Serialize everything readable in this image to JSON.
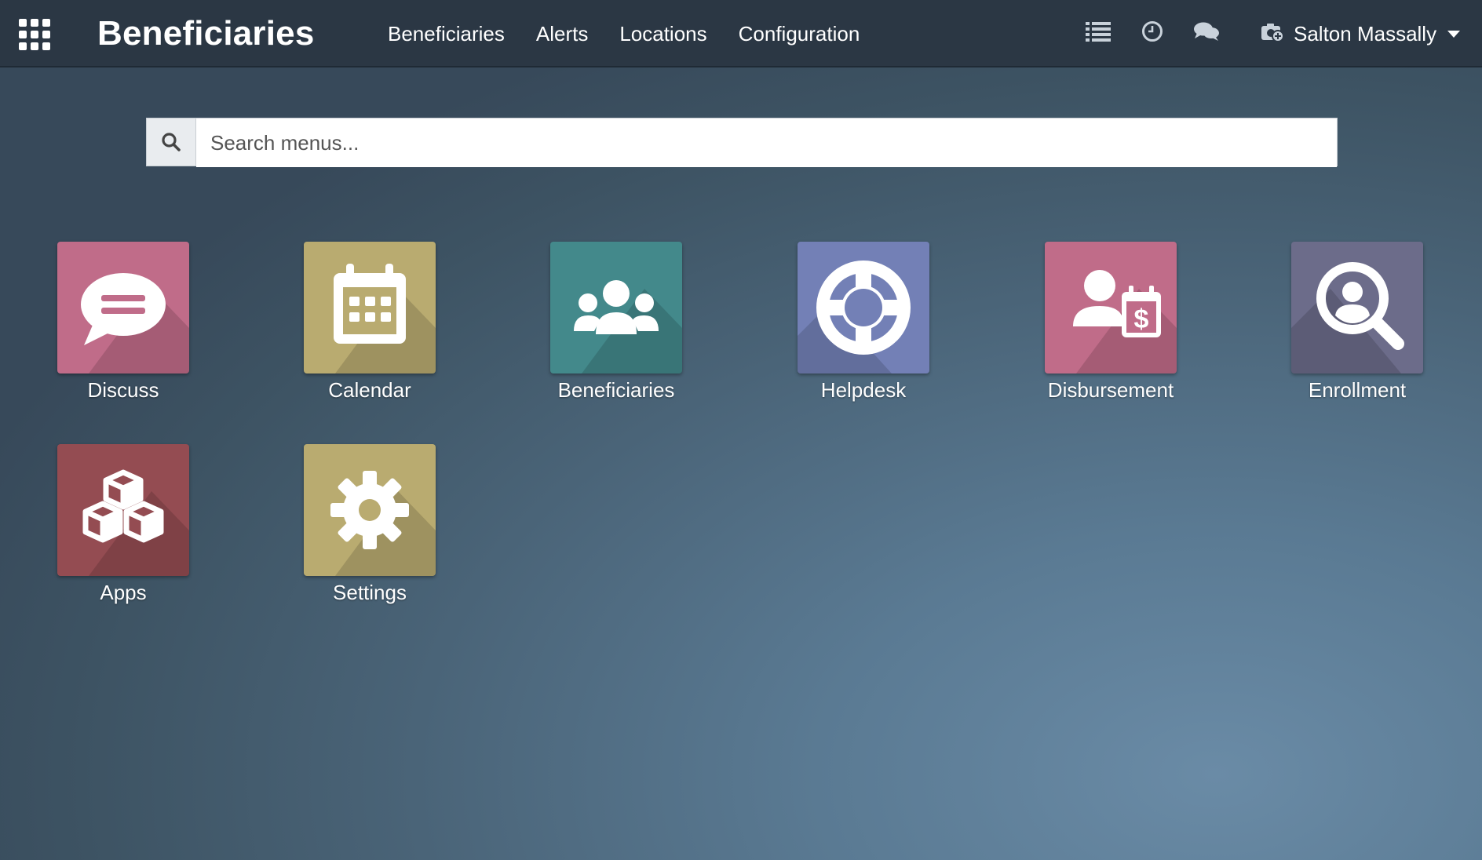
{
  "navbar": {
    "brand": "Beneficiaries",
    "menu": [
      {
        "label": "Beneficiaries"
      },
      {
        "label": "Alerts"
      },
      {
        "label": "Locations"
      },
      {
        "label": "Configuration"
      }
    ],
    "systray_icons": [
      "list-icon",
      "clock-icon",
      "chat-icon"
    ],
    "user": {
      "name": "Salton Massally",
      "icon": "company-camera-icon"
    }
  },
  "search": {
    "placeholder": "Search menus...",
    "value": "",
    "icon": "search-icon"
  },
  "apps": [
    {
      "label": "Discuss",
      "icon": "speech-bubble-icon",
      "color": "#c06c89"
    },
    {
      "label": "Calendar",
      "icon": "calendar-icon",
      "color": "#b9ab70"
    },
    {
      "label": "Beneficiaries",
      "icon": "users-group-icon",
      "color": "#43898b"
    },
    {
      "label": "Helpdesk",
      "icon": "life-ring-icon",
      "color": "#7380b6"
    },
    {
      "label": "Disbursement",
      "icon": "user-payment-icon",
      "color": "#c06c89"
    },
    {
      "label": "Enrollment",
      "icon": "magnifier-user-icon",
      "color": "#6c6c8a"
    },
    {
      "label": "Apps",
      "icon": "cubes-icon",
      "color": "#944c52"
    },
    {
      "label": "Settings",
      "icon": "gear-icon",
      "color": "#b9ab70"
    }
  ]
}
